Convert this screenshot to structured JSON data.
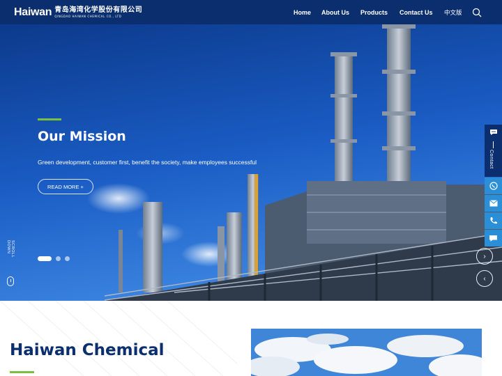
{
  "header": {
    "logo_text": "Haiwan",
    "logo_cn": "青岛海湾化学股份有限公司",
    "logo_en": "QINGDAO HAIWAN CHEMICAL CO., LTD",
    "nav": [
      {
        "label": "Home"
      },
      {
        "label": "About Us"
      },
      {
        "label": "Products"
      },
      {
        "label": "Contact Us"
      },
      {
        "label": "中文版"
      }
    ],
    "search_icon": "search-icon"
  },
  "hero": {
    "title": "Our Mission",
    "description": "Green development, customer first, benefit the society, make employees successful",
    "read_more": "READ MORE +",
    "scroll_label": "SCROLL DOWN",
    "slide_count": 3,
    "active_slide": 1,
    "next_arrow": "›",
    "prev_arrow": "‹"
  },
  "side_contact": {
    "label": "Contact",
    "buttons": [
      "whatsapp-icon",
      "mail-icon",
      "phone-icon",
      "chat-icon"
    ]
  },
  "section": {
    "title": "Haiwan Chemical"
  },
  "colors": {
    "navy": "#0b2f6e",
    "accent_green": "#7cc13e",
    "side_blue": "#2a8fd6"
  }
}
